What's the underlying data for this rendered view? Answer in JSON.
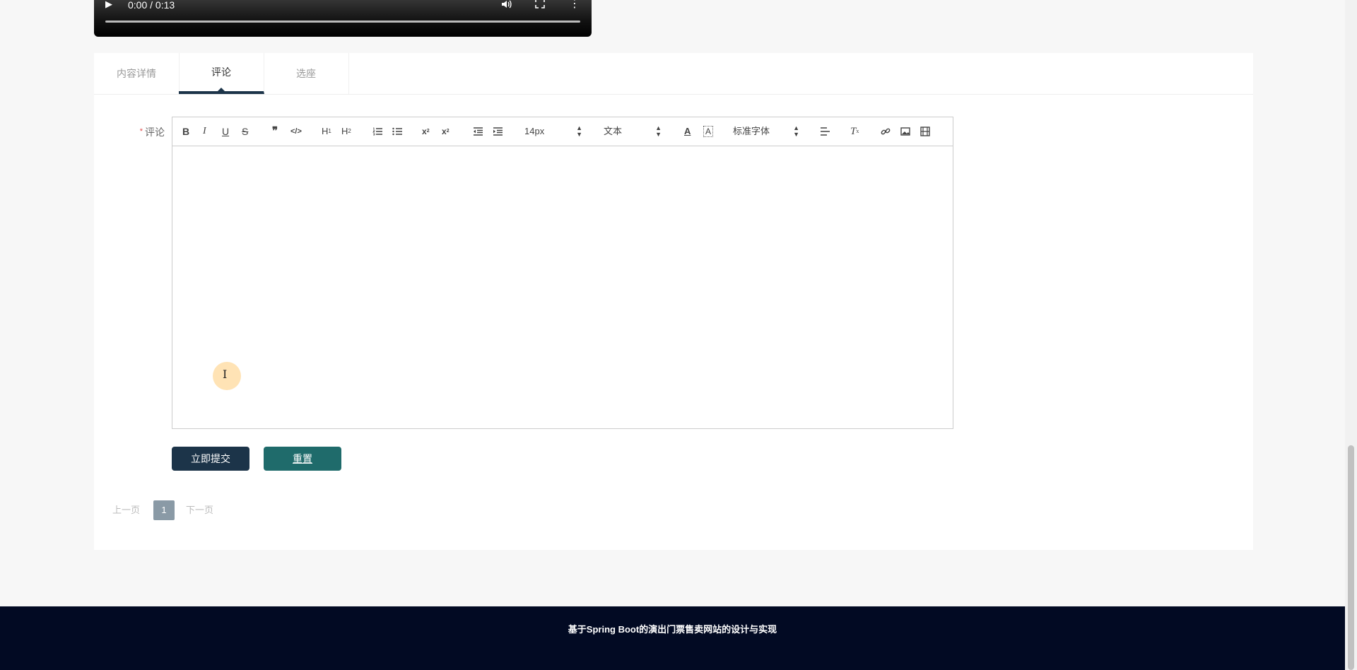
{
  "video": {
    "time": "0:00 / 0:13",
    "progress": 0,
    "icons": [
      "play-icon",
      "volume-icon",
      "fullscreen-icon",
      "more-vertical-icon"
    ]
  },
  "tabs": [
    {
      "label": "内容详情",
      "active": false
    },
    {
      "label": "评论",
      "active": true
    },
    {
      "label": "选座",
      "active": false
    }
  ],
  "form": {
    "required_mark": "*",
    "comment_label": "评论"
  },
  "editor": {
    "size_select": "14px",
    "header_select": "文本",
    "font_select": "标准字体",
    "content": ""
  },
  "buttons": {
    "submit": "立即提交",
    "reset": "重置"
  },
  "pagination": {
    "prev": "上一页",
    "current": "1",
    "next": "下一页"
  },
  "footer": {
    "text": "基于Spring Boot的演出门票售卖网站的设计与实现"
  },
  "colors": {
    "primary": "#1c3449",
    "reset": "#1f6b6b",
    "footer": "#020a23",
    "required": "#e14b4b"
  }
}
